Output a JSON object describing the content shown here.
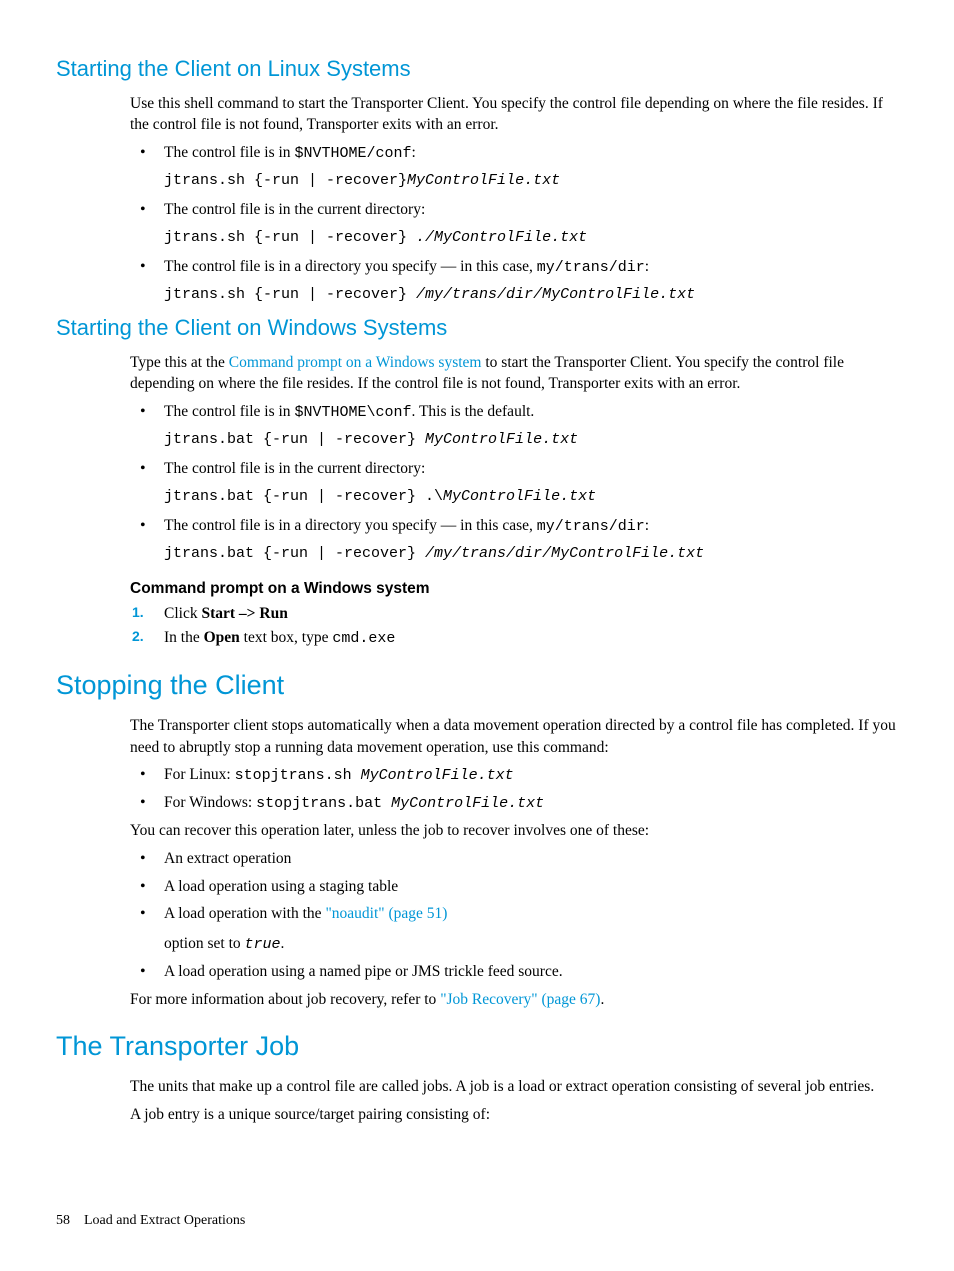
{
  "sec1": {
    "title": "Starting the Client on Linux Systems",
    "intro": "Use this shell command to start the Transporter Client. You specify the control file depending on where the file resides. If the control file is not found, Transporter exits with an error.",
    "b1_pre": "The control file is in ",
    "b1_code": "$NVTHOME/conf",
    "b1_post": ":",
    "b1_cmd_a": "jtrans.sh {-run | -recover}",
    "b1_cmd_b": "MyControlFile.txt",
    "b2_text": "The control file is in the current directory:",
    "b2_cmd_a": "jtrans.sh {-run | -recover} ",
    "b2_cmd_b": "./MyControlFile.txt",
    "b3_pre": "The control file is in a directory you specify — in this case, ",
    "b3_code": "my/trans/dir",
    "b3_post": ":",
    "b3_cmd_a": "jtrans.sh {-run | -recover} ",
    "b3_cmd_b": "/my/trans/dir/MyControlFile.txt"
  },
  "sec2": {
    "title": "Starting the Client on Windows Systems",
    "intro_a": "Type this at the ",
    "intro_link": "Command prompt on a Windows system",
    "intro_b": " to start the Transporter Client. You specify the control file depending on where the file resides. If the control file is not found, Transporter exits with an error.",
    "b1_pre": "The control file is in ",
    "b1_code": "$NVTHOME\\conf",
    "b1_post": ". This is the default.",
    "b1_cmd_a": "jtrans.bat {-run | -recover} ",
    "b1_cmd_b": "MyControlFile.txt",
    "b2_text": "The control file is in the current directory:",
    "b2_cmd_a": "jtrans.bat {-run | -recover} .\\",
    "b2_cmd_b": "MyControlFile.txt",
    "b3_pre": "The control file is in a directory you specify — in this case, ",
    "b3_code": "my/trans/dir",
    "b3_post": ":",
    "b3_cmd_a": "jtrans.bat {-run | -recover} ",
    "b3_cmd_b": "/my/trans/dir/MyControlFile.txt",
    "sub_title": "Command prompt on a Windows system",
    "step1_a": "Click ",
    "step1_b": "Start –> Run",
    "step2_a": "In the ",
    "step2_b": "Open",
    "step2_c": " text box, type ",
    "step2_d": "cmd.exe"
  },
  "sec3": {
    "title": "Stopping the Client",
    "intro": "The Transporter client stops automatically when a data movement operation directed by a control file has completed. If you need to abruptly stop a running data movement operation, use this command:",
    "b1_pre": "For Linux: ",
    "b1_cmd": "stopjtrans.sh ",
    "b1_arg": "MyControlFile.txt",
    "b2_pre": "For Windows: ",
    "b2_cmd": "stopjtrans.bat ",
    "b2_arg": "MyControlFile.txt",
    "mid": "You can recover this operation later, unless the job to recover involves one of these:",
    "b3": "An extract operation",
    "b4": "A load operation using a staging table",
    "b5_a": "A load operation with the ",
    "b5_link": "\"noaudit\" (page 51)",
    "b5_line2a": "option set to ",
    "b5_line2b": "true",
    "b5_line2c": ".",
    "b6": "A load operation using a named pipe or JMS trickle feed source.",
    "outro_a": "For more information about job recovery, refer to ",
    "outro_link": "\"Job Recovery\" (page 67)",
    "outro_b": "."
  },
  "sec4": {
    "title": "The Transporter Job",
    "p1": "The units that make up a control file are called jobs. A job is a load or extract operation consisting of several job entries.",
    "p2": "A job entry is a unique source/target pairing consisting of:"
  },
  "footer": {
    "page": "58",
    "chapter": "Load and Extract Operations"
  }
}
